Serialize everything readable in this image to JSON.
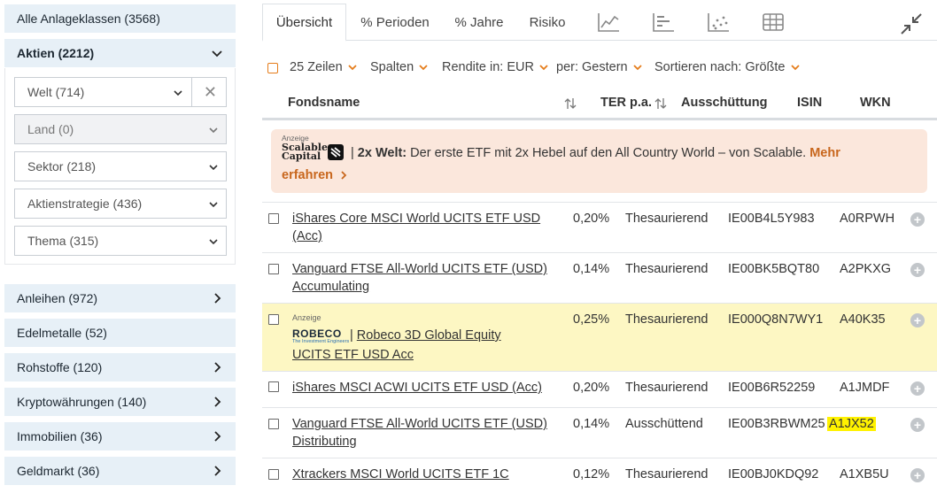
{
  "sidebar": {
    "all_classes": "Alle Anlageklassen (3568)",
    "aktien": "Aktien (2212)",
    "filters": {
      "welt": "Welt (714)",
      "land": "Land (0)",
      "sektor": "Sektor (218)",
      "strategie": "Aktienstrategie (436)",
      "thema": "Thema (315)"
    },
    "categories": [
      "Anleihen (972)",
      "Edelmetalle (52)",
      "Rohstoffe (120)",
      "Kryptowährungen (140)",
      "Immobilien (36)",
      "Geldmarkt (36)"
    ]
  },
  "tabs": {
    "overview": "Übersicht",
    "periods": "% Perioden",
    "years": "% Jahre",
    "risk": "Risiko"
  },
  "toolbar": {
    "rows": "25 Zeilen",
    "columns": "Spalten",
    "return_in": "Rendite in: EUR",
    "per": "per: Gestern",
    "sort": "Sortieren nach: Größte"
  },
  "table": {
    "headers": {
      "name": "Fondsname",
      "ter": "TER p.a.",
      "distribution": "Ausschüttung",
      "isin": "ISIN",
      "wkn": "WKN"
    },
    "ad": {
      "label": "Anzeige",
      "brand_line1": "Scalable",
      "brand_line2": "Capital",
      "headline": "2x Welt:",
      "text": "Der erste ETF mit 2x Hebel auf den All Country World – von Scalable.",
      "more1": "Mehr",
      "more2": "erfahren"
    },
    "rows": [
      {
        "name1": "iShares Core MSCI World UCITS ETF USD",
        "name2": "(Acc)",
        "ter": "0,20%",
        "dist": "Thesaurierend",
        "isin": "IE00B4L5Y983",
        "wkn": "A0RPWH"
      },
      {
        "name1": "Vanguard FTSE All-World UCITS ETF (USD)",
        "name2": "Accumulating",
        "ter": "0,14%",
        "dist": "Thesaurierend",
        "isin": "IE00BK5BQT80",
        "wkn": "A2PKXG"
      },
      {
        "label": "Anzeige",
        "brand": "ROBECO",
        "brand_sub": "The Investment Engineers",
        "name1": "Robeco 3D Global Equity",
        "name2": "UCITS ETF USD Acc",
        "ter": "0,25%",
        "dist": "Thesaurierend",
        "isin": "IE000Q8N7WY1",
        "wkn": "A40K35"
      },
      {
        "name1": "iShares MSCI ACWI UCITS ETF USD (Acc)",
        "ter": "0,20%",
        "dist": "Thesaurierend",
        "isin": "IE00B6R52259",
        "wkn": "A1JMDF"
      },
      {
        "name1": "Vanguard FTSE All-World UCITS ETF (USD)",
        "name2": "Distributing",
        "ter": "0,14%",
        "dist": "Ausschüttend",
        "isin": "IE00B3RBWM25",
        "wkn": "A1JX52"
      },
      {
        "name1": "Xtrackers MSCI World UCITS ETF 1C",
        "ter": "0,12%",
        "dist": "Thesaurierend",
        "isin": "IE00BJ0KDQ92",
        "wkn": "A1XB5U"
      }
    ]
  },
  "colors": {
    "sidebar_bg": "#e7f0f7",
    "accent_orange": "#e57c1a",
    "ad_bg": "#fbe7dc",
    "sponsored_bg": "#fdf7c3",
    "highlight": "#fff200"
  }
}
